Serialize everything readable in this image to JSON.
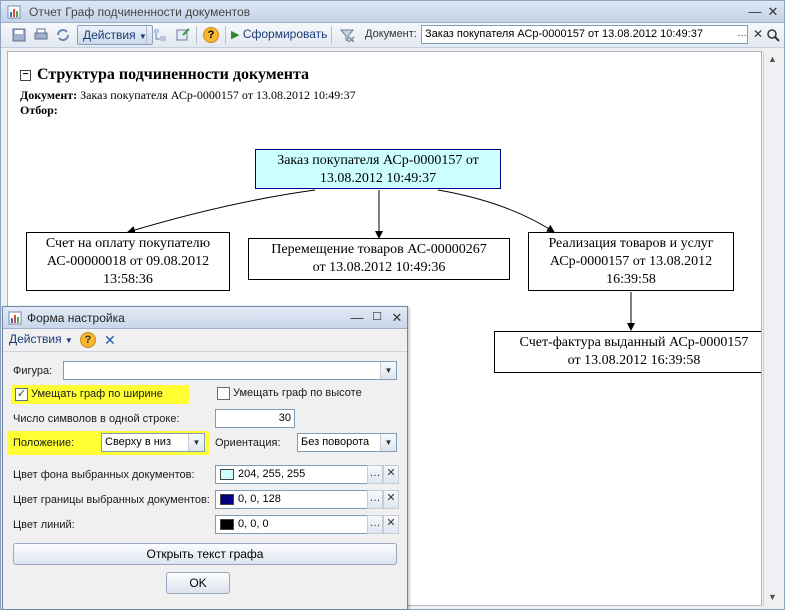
{
  "main_window": {
    "title": "Отчет Граф подчиненности документов",
    "toolbar": {
      "actions_label": "Действия",
      "form_label": "Сформировать",
      "document_label": "Документ:",
      "document_value": "Заказ покупателя АСр-0000157 от 13.08.2012 10:49:37"
    }
  },
  "report": {
    "heading": "Структура подчиненности документа",
    "document_label": "Документ:",
    "document_value": "Заказ покупателя АСр-0000157 от 13.08.2012 10:49:37",
    "filter_label": "Отбор:",
    "nodes": {
      "root": [
        "Заказ покупателя АСр-0000157 от",
        "13.08.2012 10:49:37"
      ],
      "invoice": [
        "Счет на оплату покупателю",
        "АС-00000018 от 09.08.2012",
        "13:58:36"
      ],
      "transfer": [
        "Перемещение товаров АС-00000267",
        "от 13.08.2012 10:49:36"
      ],
      "sale": [
        "Реализация товаров и услуг",
        "АСр-0000157 от 13.08.2012",
        "16:39:58"
      ],
      "tax_invoice": [
        "Счет-фактура выданный АСр-0000157",
        "от 13.08.2012 16:39:58"
      ]
    }
  },
  "dialog": {
    "title": "Форма настройка",
    "actions_label": "Действия",
    "shape_label": "Фигура:",
    "shape_value": "",
    "fit_width_label": "Умещать граф по ширине",
    "fit_width_checked": true,
    "fit_height_label": "Умещать граф по высоте",
    "fit_height_checked": false,
    "chars_per_line_label": "Число символов в одной строке:",
    "chars_per_line_value": "30",
    "position_label": "Положение:",
    "position_value": "Сверху в низ",
    "orientation_label": "Ориентация:",
    "orientation_value": "Без поворота",
    "bg_color_label": "Цвет фона выбранных документов:",
    "bg_color_value": "204, 255, 255",
    "border_color_label": "Цвет границы выбранных документов:",
    "border_color_value": "0, 0, 128",
    "line_color_label": "Цвет линий:",
    "line_color_value": "0, 0, 0",
    "open_text_button": "Открыть текст графа",
    "ok_button": "OK"
  },
  "colors": {
    "highlight": "#ffff33",
    "selected_bg": "#ccffff",
    "selected_border": "#000080",
    "line": "#000000"
  }
}
